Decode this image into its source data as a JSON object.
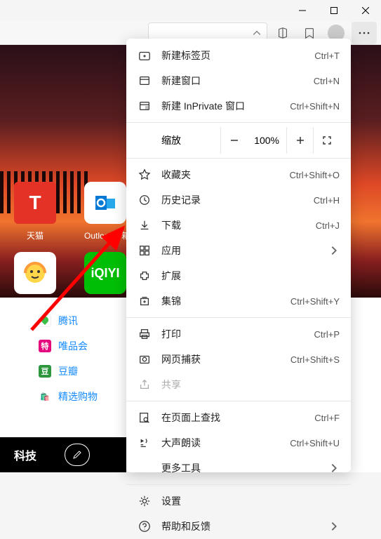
{
  "window": {
    "minimize": "－",
    "maximize": "□",
    "close": "✕"
  },
  "menu": {
    "newTab": {
      "label": "新建标签页",
      "shortcut": "Ctrl+T"
    },
    "newWindow": {
      "label": "新建窗口",
      "shortcut": "Ctrl+N"
    },
    "newInPrivate": {
      "label": "新建 InPrivate 窗口",
      "shortcut": "Ctrl+Shift+N"
    },
    "zoom": {
      "label": "缩放",
      "value": "100%"
    },
    "favorites": {
      "label": "收藏夹",
      "shortcut": "Ctrl+Shift+O"
    },
    "history": {
      "label": "历史记录",
      "shortcut": "Ctrl+H"
    },
    "downloads": {
      "label": "下载",
      "shortcut": "Ctrl+J"
    },
    "apps": {
      "label": "应用"
    },
    "extensions": {
      "label": "扩展"
    },
    "collections": {
      "label": "集锦",
      "shortcut": "Ctrl+Shift+Y"
    },
    "print": {
      "label": "打印",
      "shortcut": "Ctrl+P"
    },
    "webCapture": {
      "label": "网页捕获",
      "shortcut": "Ctrl+Shift+S"
    },
    "share": {
      "label": "共享"
    },
    "findOnPage": {
      "label": "在页面上查找",
      "shortcut": "Ctrl+F"
    },
    "readAloud": {
      "label": "大声朗读",
      "shortcut": "Ctrl+Shift+U"
    },
    "moreTools": {
      "label": "更多工具"
    },
    "settings": {
      "label": "设置"
    },
    "helpFeedback": {
      "label": "帮助和反馈"
    }
  },
  "tiles": {
    "tmall": "天猫",
    "outlook": "Outlook邮箱"
  },
  "favs": {
    "tencent": "腾讯",
    "vip": "唯品会",
    "douban": "豆瓣",
    "shopping": "精选购物"
  },
  "footer": {
    "category": "科技"
  }
}
